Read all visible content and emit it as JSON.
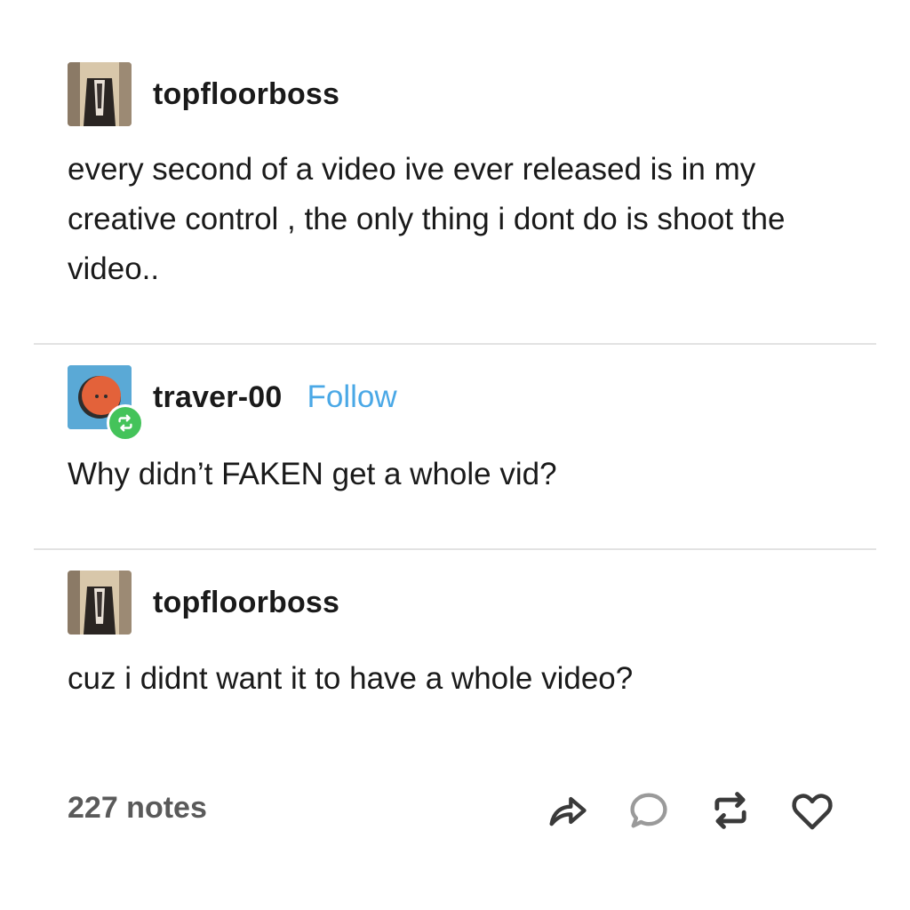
{
  "posts": [
    {
      "username": "topfloorboss",
      "text": "every second of a video ive ever released is in my creative control , the only thing i dont do is shoot the video.."
    },
    {
      "username": "traver-00",
      "follow_label": "Follow",
      "text": "Why didn’t FAKEN get a whole vid?"
    },
    {
      "username": "topfloorboss",
      "text": "cuz i didnt want it to have a whole video?"
    }
  ],
  "footer": {
    "notes": "227 notes",
    "actions": [
      "share-icon",
      "reply-icon",
      "reblog-icon",
      "like-icon"
    ]
  },
  "colors": {
    "follow": "#4aa8e6",
    "reblog_badge": "#44c35a",
    "divider": "#e2e2e2",
    "icon": "#3a3a3a",
    "reply_icon": "#9a9a9a"
  }
}
